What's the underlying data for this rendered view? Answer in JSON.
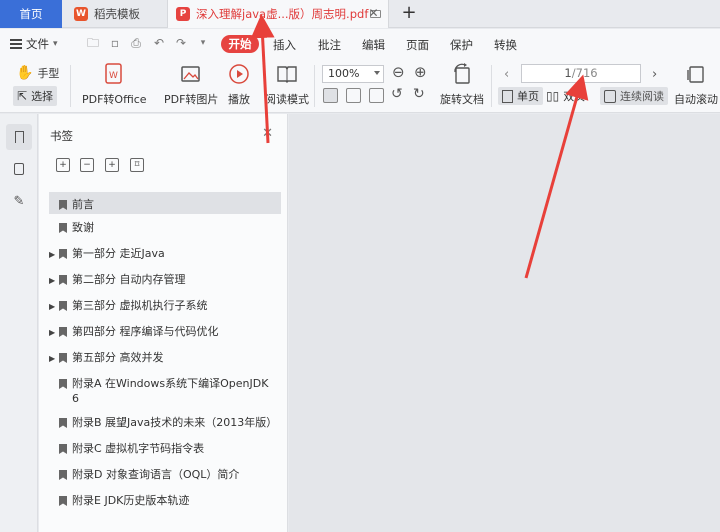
{
  "tabs": {
    "home": "首页",
    "template": "稻壳模板",
    "document": "深入理解java虚...版）周志明.pdf"
  },
  "menu": {
    "file": "文件",
    "start": "开始",
    "insert": "插入",
    "annotate": "批注",
    "edit": "编辑",
    "page": "页面",
    "protect": "保护",
    "convert": "转换"
  },
  "toolbar": {
    "hand": "手型",
    "select": "选择",
    "pdf_to_office": "PDF转Office",
    "pdf_to_image": "PDF转图片",
    "play": "播放",
    "read_mode": "阅读模式",
    "zoom": "100%",
    "rotate_doc": "旋转文档",
    "page_current": "1",
    "page_total": "/716",
    "single_page": "单页",
    "double_page": "双页",
    "continuous": "连续阅读",
    "auto_scroll": "自动滚动"
  },
  "panel": {
    "title": "书签",
    "bookmarks": [
      {
        "label": "前言",
        "expandable": false,
        "selected": true
      },
      {
        "label": "致谢",
        "expandable": false
      },
      {
        "label": "第一部分 走近Java",
        "expandable": true
      },
      {
        "label": "第二部分 自动内存管理",
        "expandable": true
      },
      {
        "label": "第三部分 虚拟机执行子系统",
        "expandable": true
      },
      {
        "label": "第四部分 程序编译与代码优化",
        "expandable": true
      },
      {
        "label": "第五部分 高效并发",
        "expandable": true
      },
      {
        "label": "附录A 在Windows系统下编译OpenJDK",
        "label2": "6",
        "expandable": false
      },
      {
        "label": "附录B 展望Java技术的未来（2013年版）",
        "expandable": false
      },
      {
        "label": "附录C 虚拟机字节码指令表",
        "expandable": false
      },
      {
        "label": "附录D 对象查询语言（OQL）简介",
        "expandable": false
      },
      {
        "label": "附录E JDK历史版本轨迹",
        "expandable": false
      }
    ]
  },
  "colors": {
    "accent_blue": "#3a6fd8",
    "accent_red": "#e64340",
    "annotation_arrow": "#e8403a"
  }
}
